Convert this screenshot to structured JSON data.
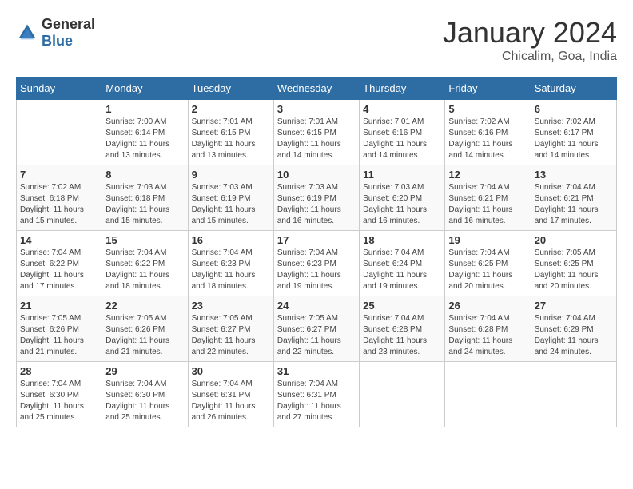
{
  "header": {
    "logo_general": "General",
    "logo_blue": "Blue",
    "month": "January 2024",
    "location": "Chicalim, Goa, India"
  },
  "weekdays": [
    "Sunday",
    "Monday",
    "Tuesday",
    "Wednesday",
    "Thursday",
    "Friday",
    "Saturday"
  ],
  "weeks": [
    [
      {
        "day": "",
        "sunrise": "",
        "sunset": "",
        "daylight": ""
      },
      {
        "day": "1",
        "sunrise": "Sunrise: 7:00 AM",
        "sunset": "Sunset: 6:14 PM",
        "daylight": "Daylight: 11 hours and 13 minutes."
      },
      {
        "day": "2",
        "sunrise": "Sunrise: 7:01 AM",
        "sunset": "Sunset: 6:15 PM",
        "daylight": "Daylight: 11 hours and 13 minutes."
      },
      {
        "day": "3",
        "sunrise": "Sunrise: 7:01 AM",
        "sunset": "Sunset: 6:15 PM",
        "daylight": "Daylight: 11 hours and 14 minutes."
      },
      {
        "day": "4",
        "sunrise": "Sunrise: 7:01 AM",
        "sunset": "Sunset: 6:16 PM",
        "daylight": "Daylight: 11 hours and 14 minutes."
      },
      {
        "day": "5",
        "sunrise": "Sunrise: 7:02 AM",
        "sunset": "Sunset: 6:16 PM",
        "daylight": "Daylight: 11 hours and 14 minutes."
      },
      {
        "day": "6",
        "sunrise": "Sunrise: 7:02 AM",
        "sunset": "Sunset: 6:17 PM",
        "daylight": "Daylight: 11 hours and 14 minutes."
      }
    ],
    [
      {
        "day": "7",
        "sunrise": "Sunrise: 7:02 AM",
        "sunset": "Sunset: 6:18 PM",
        "daylight": "Daylight: 11 hours and 15 minutes."
      },
      {
        "day": "8",
        "sunrise": "Sunrise: 7:03 AM",
        "sunset": "Sunset: 6:18 PM",
        "daylight": "Daylight: 11 hours and 15 minutes."
      },
      {
        "day": "9",
        "sunrise": "Sunrise: 7:03 AM",
        "sunset": "Sunset: 6:19 PM",
        "daylight": "Daylight: 11 hours and 15 minutes."
      },
      {
        "day": "10",
        "sunrise": "Sunrise: 7:03 AM",
        "sunset": "Sunset: 6:19 PM",
        "daylight": "Daylight: 11 hours and 16 minutes."
      },
      {
        "day": "11",
        "sunrise": "Sunrise: 7:03 AM",
        "sunset": "Sunset: 6:20 PM",
        "daylight": "Daylight: 11 hours and 16 minutes."
      },
      {
        "day": "12",
        "sunrise": "Sunrise: 7:04 AM",
        "sunset": "Sunset: 6:21 PM",
        "daylight": "Daylight: 11 hours and 16 minutes."
      },
      {
        "day": "13",
        "sunrise": "Sunrise: 7:04 AM",
        "sunset": "Sunset: 6:21 PM",
        "daylight": "Daylight: 11 hours and 17 minutes."
      }
    ],
    [
      {
        "day": "14",
        "sunrise": "Sunrise: 7:04 AM",
        "sunset": "Sunset: 6:22 PM",
        "daylight": "Daylight: 11 hours and 17 minutes."
      },
      {
        "day": "15",
        "sunrise": "Sunrise: 7:04 AM",
        "sunset": "Sunset: 6:22 PM",
        "daylight": "Daylight: 11 hours and 18 minutes."
      },
      {
        "day": "16",
        "sunrise": "Sunrise: 7:04 AM",
        "sunset": "Sunset: 6:23 PM",
        "daylight": "Daylight: 11 hours and 18 minutes."
      },
      {
        "day": "17",
        "sunrise": "Sunrise: 7:04 AM",
        "sunset": "Sunset: 6:23 PM",
        "daylight": "Daylight: 11 hours and 19 minutes."
      },
      {
        "day": "18",
        "sunrise": "Sunrise: 7:04 AM",
        "sunset": "Sunset: 6:24 PM",
        "daylight": "Daylight: 11 hours and 19 minutes."
      },
      {
        "day": "19",
        "sunrise": "Sunrise: 7:04 AM",
        "sunset": "Sunset: 6:25 PM",
        "daylight": "Daylight: 11 hours and 20 minutes."
      },
      {
        "day": "20",
        "sunrise": "Sunrise: 7:05 AM",
        "sunset": "Sunset: 6:25 PM",
        "daylight": "Daylight: 11 hours and 20 minutes."
      }
    ],
    [
      {
        "day": "21",
        "sunrise": "Sunrise: 7:05 AM",
        "sunset": "Sunset: 6:26 PM",
        "daylight": "Daylight: 11 hours and 21 minutes."
      },
      {
        "day": "22",
        "sunrise": "Sunrise: 7:05 AM",
        "sunset": "Sunset: 6:26 PM",
        "daylight": "Daylight: 11 hours and 21 minutes."
      },
      {
        "day": "23",
        "sunrise": "Sunrise: 7:05 AM",
        "sunset": "Sunset: 6:27 PM",
        "daylight": "Daylight: 11 hours and 22 minutes."
      },
      {
        "day": "24",
        "sunrise": "Sunrise: 7:05 AM",
        "sunset": "Sunset: 6:27 PM",
        "daylight": "Daylight: 11 hours and 22 minutes."
      },
      {
        "day": "25",
        "sunrise": "Sunrise: 7:04 AM",
        "sunset": "Sunset: 6:28 PM",
        "daylight": "Daylight: 11 hours and 23 minutes."
      },
      {
        "day": "26",
        "sunrise": "Sunrise: 7:04 AM",
        "sunset": "Sunset: 6:28 PM",
        "daylight": "Daylight: 11 hours and 24 minutes."
      },
      {
        "day": "27",
        "sunrise": "Sunrise: 7:04 AM",
        "sunset": "Sunset: 6:29 PM",
        "daylight": "Daylight: 11 hours and 24 minutes."
      }
    ],
    [
      {
        "day": "28",
        "sunrise": "Sunrise: 7:04 AM",
        "sunset": "Sunset: 6:30 PM",
        "daylight": "Daylight: 11 hours and 25 minutes."
      },
      {
        "day": "29",
        "sunrise": "Sunrise: 7:04 AM",
        "sunset": "Sunset: 6:30 PM",
        "daylight": "Daylight: 11 hours and 25 minutes."
      },
      {
        "day": "30",
        "sunrise": "Sunrise: 7:04 AM",
        "sunset": "Sunset: 6:31 PM",
        "daylight": "Daylight: 11 hours and 26 minutes."
      },
      {
        "day": "31",
        "sunrise": "Sunrise: 7:04 AM",
        "sunset": "Sunset: 6:31 PM",
        "daylight": "Daylight: 11 hours and 27 minutes."
      },
      {
        "day": "",
        "sunrise": "",
        "sunset": "",
        "daylight": ""
      },
      {
        "day": "",
        "sunrise": "",
        "sunset": "",
        "daylight": ""
      },
      {
        "day": "",
        "sunrise": "",
        "sunset": "",
        "daylight": ""
      }
    ]
  ]
}
